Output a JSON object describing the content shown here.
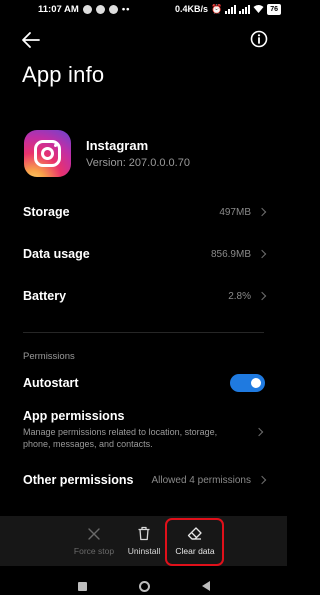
{
  "status_bar": {
    "time": "11:07 AM",
    "net_speed": "0.4KB/s",
    "battery": "76"
  },
  "header": {
    "title": "App info"
  },
  "app": {
    "name": "Instagram",
    "version": "Version: 207.0.0.0.70"
  },
  "rows": {
    "storage": {
      "label": "Storage",
      "value": "497MB"
    },
    "data_usage": {
      "label": "Data usage",
      "value": "856.9MB"
    },
    "battery": {
      "label": "Battery",
      "value": "2.8%"
    }
  },
  "permissions": {
    "section_label": "Permissions",
    "autostart": {
      "label": "Autostart",
      "enabled": true
    },
    "app_permissions": {
      "label": "App permissions",
      "description": "Manage permissions related to location, storage, phone, messages, and contacts."
    },
    "other_permissions": {
      "label": "Other permissions",
      "value": "Allowed 4 permissions"
    }
  },
  "actions": {
    "force_stop": "Force stop",
    "uninstall": "Uninstall",
    "clear_data": "Clear data"
  },
  "colors": {
    "accent": "#1f7ae0",
    "highlight": "#e0101a"
  }
}
